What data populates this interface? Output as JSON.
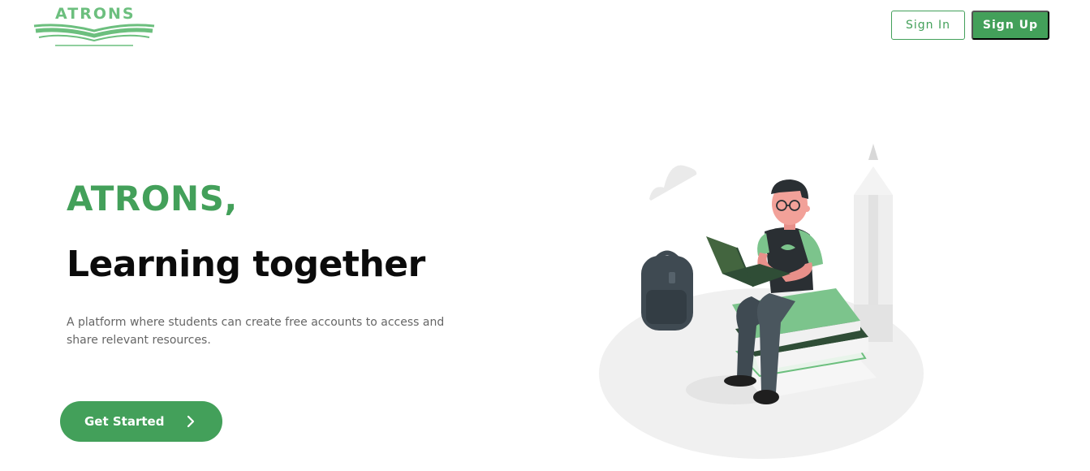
{
  "header": {
    "logo_text": "ATRONS",
    "signin_label": "Sign In",
    "signup_label": "Sign Up"
  },
  "hero": {
    "brand": "ATRONS,",
    "headline": "Learning together",
    "description": "A platform where students can create free accounts to access and share relevant resources.",
    "cta_label": "Get Started"
  },
  "colors": {
    "accent": "#43a05a",
    "logo": "#6cbf7e"
  },
  "icons": {
    "cta": "chevron-right-icon",
    "logo": "book-icon"
  }
}
